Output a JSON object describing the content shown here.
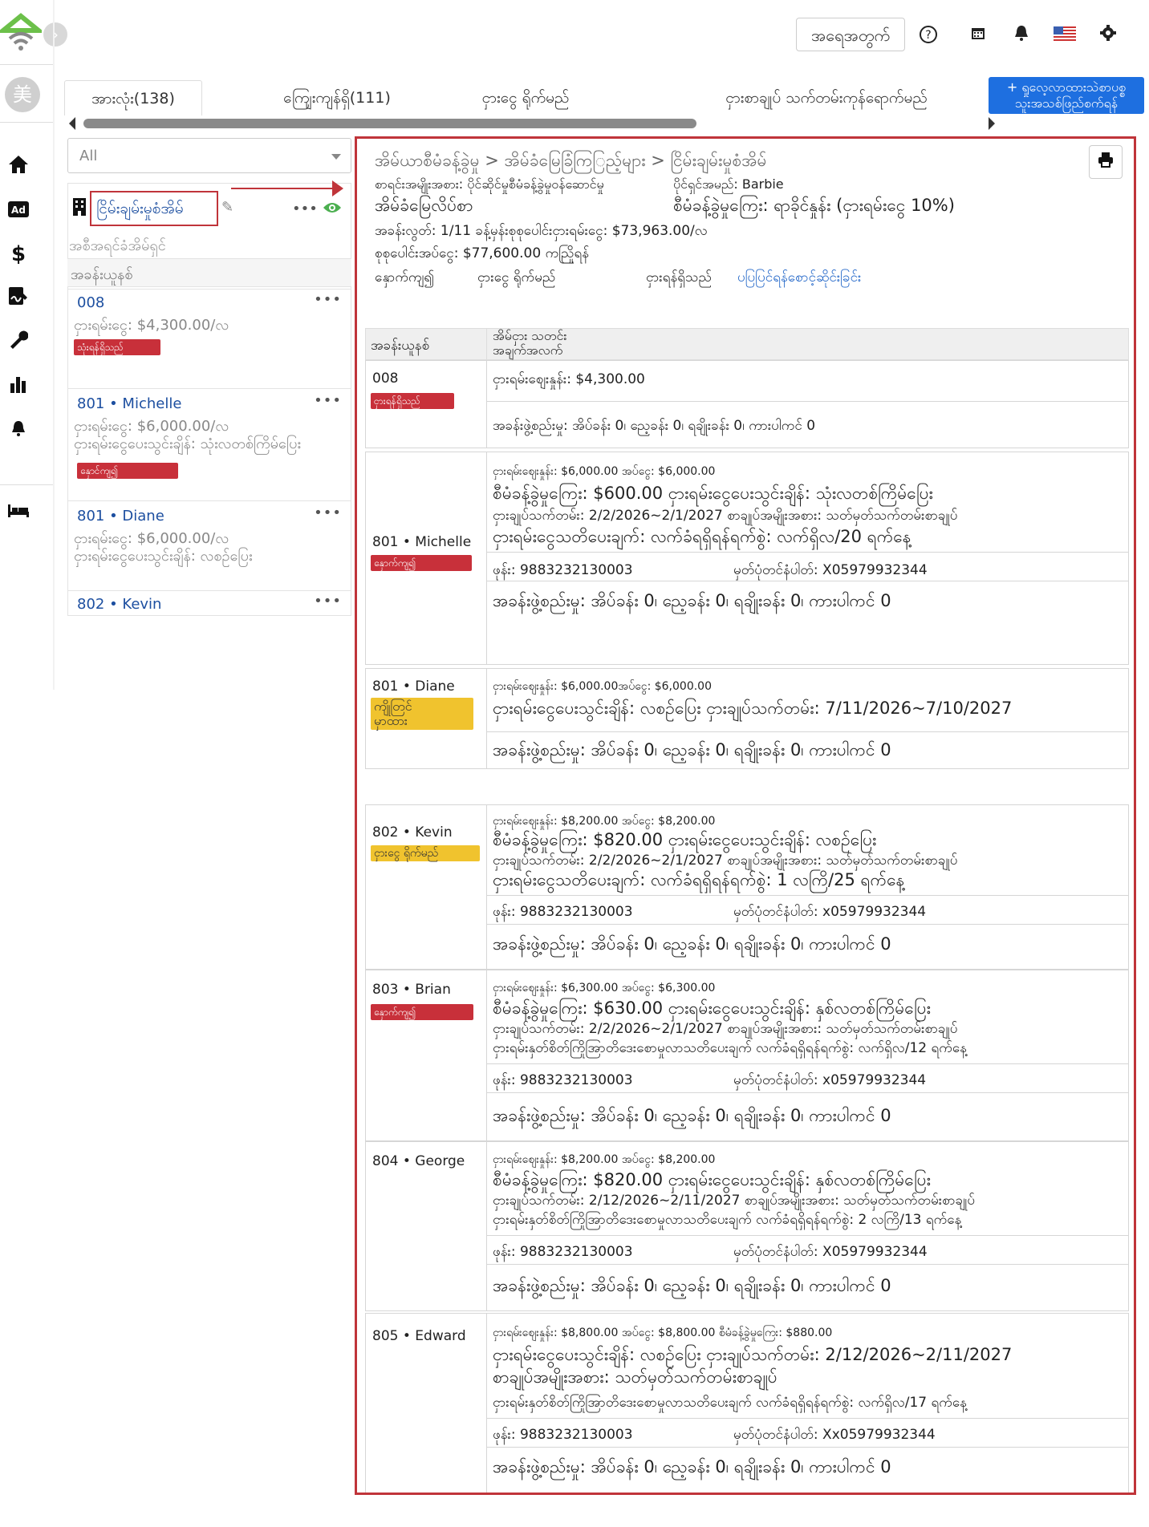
{
  "topbar": {
    "search_label": "အရေအတွက်",
    "help_icon": "question-circle-icon",
    "calendar_icon": "calendar-icon",
    "bell_icon": "bell-icon",
    "flag_icon": "us-flag-icon",
    "settings_icon": "gear-icon"
  },
  "sidebar": {
    "avatar_text": "美",
    "items": [
      "home-icon",
      "ad-icon",
      "dollar-icon",
      "signature-icon",
      "wrench-icon",
      "bar-chart-icon",
      "bell-icon",
      "bed-icon"
    ]
  },
  "tabs": [
    {
      "label": "အားလုံး(138)"
    },
    {
      "label": "ကျြေးကျန်ရှိ(111)"
    },
    {
      "label": "ငှားငွေ ရိုက်မည်"
    },
    {
      "label": "ငှားစာချုပ် သက်တမ်းကုန်ရောက်မည်"
    }
  ],
  "new_button": "+ ရှုလေ့လာထားသဲစာပစ္စ\nသူးအသစ်ဖြည်စက်ရန်",
  "filter": {
    "value": "All"
  },
  "property": {
    "name": "ငြိမ်းချမ်းမှုစံအိမ်",
    "owner_placeholder": "အစီအရင်ခံအိမ်ရှင်",
    "room_header": "အခန်းယူနစ်"
  },
  "list_items": [
    {
      "title": "008",
      "line1": "ငှားရမ်းငွေ: $4,300.00/လ",
      "line2": "",
      "tag": "သုံးရန်ရှိသည်",
      "tag_color": "red"
    },
    {
      "title": "801 • Michelle",
      "line1": "ငှားရမ်းငွေ: $6,000.00/လ",
      "line2": "ငှားရမ်းငွေပေးသွင်းချိန်: သုံးလတစ်ကြိမ်ပြေး",
      "tag": "နှောင်ကျ၍",
      "tag_color": "red"
    },
    {
      "title": "801 • Diane",
      "line1": "ငှားရမ်းငွေ: $6,000.00/လ",
      "line2": "ငှားရမ်းငွေပေးသွင်းချိန်: လစဉ်ပြေး",
      "tag": "",
      "tag_color": ""
    },
    {
      "title": "802 • Kevin",
      "line1": "",
      "line2": "",
      "tag": "",
      "tag_color": ""
    }
  ],
  "detail": {
    "breadcrumb": "အိမ်ယာစီမံခန့်ခွဲမှု > အိမ်ခံမြေခြံကြြည့်များ > ငြိမ်းချမ်းမှုစံအိမ်",
    "mgmt_type": "စာရင်းအမျိုးအစား: ပိုင်ဆိုင်မှုစီမံခန့်ခွဲမှုဝန်ဆောင်မှု",
    "owner": "ပိုင်ရှင်အမည်: Barbie",
    "contract_label": "အိမ်ခံမြေလိပ်စာ",
    "fee": "စီမံခန့်ခွဲမှုကြေး: ရာခိုင်နှုန်း (ငှားရမ်းငွေ 10%)",
    "vacancy": "အခန်းလွတ်: 1/11 ခန့်မှန်းစုစုပေါင်းငှားရမ်းငွေ: $73,963.00/လ",
    "total": "စုစုပေါင်းအပ်ငွေ: $77,600.00 ကညြိုရန်",
    "links": [
      "နှောက်ကျ၍",
      "ငှားငွေ ရိုက်မည်",
      "ငှားရန်ရှိသည်",
      "ပပြပြင်ရန်စောင့်ဆိုင်းခြင်း"
    ],
    "col_unit": "အခန်းယူနစ်",
    "col_info": "အိမ်ငှား သတင်း\nအချက်အလက်",
    "print_icon": "printer-icon"
  },
  "rows": [
    {
      "unit": "008",
      "tag": "ငှားရန်ရှိသည်",
      "tag_color": "red",
      "lines": [
        "ငှားရမ်းစျေးနှုန်း: $4,300.00"
      ],
      "rooms": "အခန်းဖွဲ့စည်းမှု: အိပ်ခန်း 0၊ ညေ့ခန်း 0၊ ရချိုးခန်း 0၊ ကားပါကင် 0"
    },
    {
      "unit": "801 • Michelle",
      "tag": "နှောက်ကျ၍",
      "tag_color": "red",
      "lines": [
        "ငှားရမ်းစျေးနှုန်း: $6,000.00   အပ်ငွေ: $6,000.00",
        "စီမံခန့်ခွဲမှုကြေး: $600.00 ငှားရမ်းငွေပေးသွင်းချိန်: သုံးလတစ်ကြိမ်ပြေး",
        "ငှားချုပ်သက်တမ်း: 2/2/2026~2/1/2027 စာချုပ်အမျိုးအစား: သတ်မှတ်သက်တမ်းစာချုပ်",
        "ငှားရမ်းငွေသတိပေးချက်: လက်ခံရရှိရန်ရက်စွဲ: လက်ရှိလ/20 ရက်နေ့"
      ],
      "phone": "ဖုန်း: 9883232130003",
      "id": "မှတ်ပုံတင်နံပါတ်: X05979932344",
      "rooms": "အခန်းဖွဲ့စည်းမှု: အိပ်ခန်း 0၊ ညေ့ခန်း 0၊ ရချိုးခန်း 0၊ ကားပါကင် 0"
    },
    {
      "unit": "801 • Diane",
      "tag": "ကျိုတြင်\nမှာထား",
      "tag_color": "yellow",
      "lines": [
        "ငှားရမ်းစျေးနှုန်း: $6,000.00အပ်ငွေ: $6,000.00",
        "ငှားရမ်းငွေပေးသွင်းချိန်: လစဉ်ပြေး ငှားချုပ်သက်တမ်း: 7/11/2026~7/10/2027"
      ],
      "rooms": "အခန်းဖွဲ့စည်းမှု: အိပ်ခန်း 0၊ ညေ့ခန်း 0၊ ရချိုးခန်း 0၊ ကားပါကင် 0"
    },
    {
      "unit": "802 • Kevin",
      "tag": "ငှားငွေ ရိုက်မည်",
      "tag_color": "yellow",
      "lines": [
        "ငှားရမ်းစျေးနှုန်း: $8,200.00   အပ်ငွေ: $8,200.00",
        "စီမံခန့်ခွဲမှုကြေး: $820.00 ငှားရမ်းငွေပေးသွင်းချိန်: လစဉ်ပြေး",
        "ငှားချုပ်သက်တမ်း: 2/2/2026~2/1/2027 စာချုပ်အမျိုးအစား: သတ်မှတ်သက်တမ်းစာချုပ်",
        "ငှားရမ်းငွေသတိပေးချက်: လက်ခံရရှိရန်ရက်စွဲ: 1 လကြိ/25 ရက်နေ့"
      ],
      "phone": "ဖုန်း: 9883232130003",
      "id": "မှတ်ပုံတင်နံပါတ်: x05979932344",
      "rooms": "အခန်းဖွဲ့စည်းမှု: အိပ်ခန်း 0၊ ညေ့ခန်း 0၊ ရချိုးခန်း 0၊ ကားပါကင် 0"
    },
    {
      "unit": "803 • Brian",
      "tag": "နှောက်ကျ၍",
      "tag_color": "red",
      "lines": [
        "ငှားရမ်းစျေးနှုန်း: $6,300.00   အပ်ငွေ: $6,300.00",
        "စီမံခန့်ခွဲမှုကြေး: $630.00 ငှားရမ်းငွေပေးသွင်းချိန်: နှစ်လတစ်ကြိမ်ပြေး",
        "ငှားချုပ်သက်တမ်း: 2/2/2026~2/1/2027 စာချုပ်အမျိုးအစား: သတ်မှတ်သက်တမ်းစာချုပ်",
        "ငှားရမ်းနှတ်စိတ်ကြိုအြာတိဒေးစောမှုလာသတိပေးချက်   လက်ခံရရှိရန်ရက်စွဲ: လက်ရှိလ/12 ရက်နေ့"
      ],
      "phone": "ဖုန်း: 9883232130003",
      "id": "မှတ်ပုံတင်နံပါတ်: x05979932344",
      "rooms": "အခန်းဖွဲ့စည်းမှု: အိပ်ခန်း 0၊ ညေ့ခန်း 0၊ ရချိုးခန်း 0၊ ကားပါကင် 0"
    },
    {
      "unit": "804 • George",
      "tag": "",
      "tag_color": "",
      "lines": [
        "ငှားရမ်းစျေးနှုန်း: $8,200.00   အပ်ငွေ: $8,200.00",
        "စီမံခန့်ခွဲမှုကြေး: $820.00 ငှားရမ်းငွေပေးသွင်းချိန်: နှစ်လတစ်ကြိမ်ပြေး",
        "ငှားချုပ်သက်တမ်း: 2/12/2026~2/11/2027 စာချုပ်အမျိုးအစား: သတ်မှတ်သက်တမ်းစာချုပ်",
        "ငှားရမ်းနှတ်စိတ်ကြိုအြာတိဒေးစောမှုလာသတိပေးချက်   လက်ခံရရှိရန်ရက်စွဲ: 2 လကြိ/13 ရက်နေ့"
      ],
      "phone": "ဖုန်း: 9883232130003",
      "id": "မှတ်ပုံတင်နံပါတ်: X05979932344",
      "rooms": "အခန်းဖွဲ့စည်းမှု: အိပ်ခန်း 0၊ ညေ့ခန်း 0၊ ရချိုးခန်း 0၊ ကားပါကင် 0"
    },
    {
      "unit": "805 • Edward",
      "tag": "",
      "tag_color": "",
      "lines": [
        "ငှားရမ်းစျေးနှုန်း: $8,800.00   အပ်ငွေ: $8,800.00 စီမံခန့်ခွဲမှုကြေး: $880.00",
        "ငှားရမ်းငွေပေးသွင်းချိန်: လစဉ်ပြေး ငှားချုပ်သက်တမ်း: 2/12/2026~2/11/2027",
        "စာချုပ်အမျိုးအစား: သတ်မှတ်သက်တမ်းစာချုပ်",
        "ငှားရမ်းနှတ်စိတ်ကြိုအြာတိဒေးစောမှုလာသတိပေးချက်   လက်ခံရရှိရန်ရက်စွဲ: လက်ရှိလ/17 ရက်နေ့"
      ],
      "phone": "ဖုန်း: 9883232130003",
      "id": "မှတ်ပုံတင်နံပါတ်: Xx05979932344",
      "rooms": "အခန်းဖွဲ့စည်းမှု: အိပ်ခန်း 0၊ ညေ့ခန်း 0၊ ရချိုးခန်း 0၊ ကားပါကင် 0"
    }
  ]
}
